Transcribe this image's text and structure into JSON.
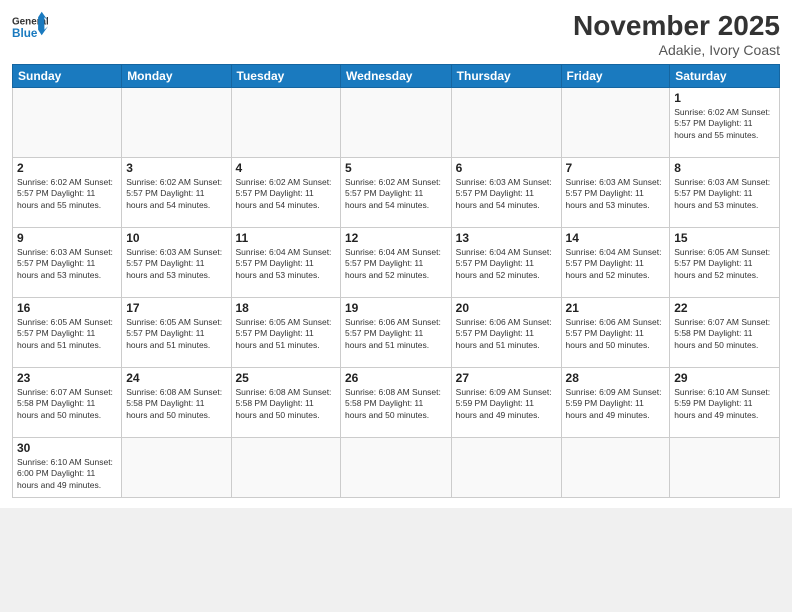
{
  "logo": {
    "text_general": "General",
    "text_blue": "Blue"
  },
  "header": {
    "month": "November 2025",
    "location": "Adakie, Ivory Coast"
  },
  "days_of_week": [
    "Sunday",
    "Monday",
    "Tuesday",
    "Wednesday",
    "Thursday",
    "Friday",
    "Saturday"
  ],
  "weeks": [
    [
      {
        "day": "",
        "info": ""
      },
      {
        "day": "",
        "info": ""
      },
      {
        "day": "",
        "info": ""
      },
      {
        "day": "",
        "info": ""
      },
      {
        "day": "",
        "info": ""
      },
      {
        "day": "",
        "info": ""
      },
      {
        "day": "1",
        "info": "Sunrise: 6:02 AM\nSunset: 5:57 PM\nDaylight: 11 hours\nand 55 minutes."
      }
    ],
    [
      {
        "day": "2",
        "info": "Sunrise: 6:02 AM\nSunset: 5:57 PM\nDaylight: 11 hours\nand 55 minutes."
      },
      {
        "day": "3",
        "info": "Sunrise: 6:02 AM\nSunset: 5:57 PM\nDaylight: 11 hours\nand 54 minutes."
      },
      {
        "day": "4",
        "info": "Sunrise: 6:02 AM\nSunset: 5:57 PM\nDaylight: 11 hours\nand 54 minutes."
      },
      {
        "day": "5",
        "info": "Sunrise: 6:02 AM\nSunset: 5:57 PM\nDaylight: 11 hours\nand 54 minutes."
      },
      {
        "day": "6",
        "info": "Sunrise: 6:03 AM\nSunset: 5:57 PM\nDaylight: 11 hours\nand 54 minutes."
      },
      {
        "day": "7",
        "info": "Sunrise: 6:03 AM\nSunset: 5:57 PM\nDaylight: 11 hours\nand 53 minutes."
      },
      {
        "day": "8",
        "info": "Sunrise: 6:03 AM\nSunset: 5:57 PM\nDaylight: 11 hours\nand 53 minutes."
      }
    ],
    [
      {
        "day": "9",
        "info": "Sunrise: 6:03 AM\nSunset: 5:57 PM\nDaylight: 11 hours\nand 53 minutes."
      },
      {
        "day": "10",
        "info": "Sunrise: 6:03 AM\nSunset: 5:57 PM\nDaylight: 11 hours\nand 53 minutes."
      },
      {
        "day": "11",
        "info": "Sunrise: 6:04 AM\nSunset: 5:57 PM\nDaylight: 11 hours\nand 53 minutes."
      },
      {
        "day": "12",
        "info": "Sunrise: 6:04 AM\nSunset: 5:57 PM\nDaylight: 11 hours\nand 52 minutes."
      },
      {
        "day": "13",
        "info": "Sunrise: 6:04 AM\nSunset: 5:57 PM\nDaylight: 11 hours\nand 52 minutes."
      },
      {
        "day": "14",
        "info": "Sunrise: 6:04 AM\nSunset: 5:57 PM\nDaylight: 11 hours\nand 52 minutes."
      },
      {
        "day": "15",
        "info": "Sunrise: 6:05 AM\nSunset: 5:57 PM\nDaylight: 11 hours\nand 52 minutes."
      }
    ],
    [
      {
        "day": "16",
        "info": "Sunrise: 6:05 AM\nSunset: 5:57 PM\nDaylight: 11 hours\nand 51 minutes."
      },
      {
        "day": "17",
        "info": "Sunrise: 6:05 AM\nSunset: 5:57 PM\nDaylight: 11 hours\nand 51 minutes."
      },
      {
        "day": "18",
        "info": "Sunrise: 6:05 AM\nSunset: 5:57 PM\nDaylight: 11 hours\nand 51 minutes."
      },
      {
        "day": "19",
        "info": "Sunrise: 6:06 AM\nSunset: 5:57 PM\nDaylight: 11 hours\nand 51 minutes."
      },
      {
        "day": "20",
        "info": "Sunrise: 6:06 AM\nSunset: 5:57 PM\nDaylight: 11 hours\nand 51 minutes."
      },
      {
        "day": "21",
        "info": "Sunrise: 6:06 AM\nSunset: 5:57 PM\nDaylight: 11 hours\nand 50 minutes."
      },
      {
        "day": "22",
        "info": "Sunrise: 6:07 AM\nSunset: 5:58 PM\nDaylight: 11 hours\nand 50 minutes."
      }
    ],
    [
      {
        "day": "23",
        "info": "Sunrise: 6:07 AM\nSunset: 5:58 PM\nDaylight: 11 hours\nand 50 minutes."
      },
      {
        "day": "24",
        "info": "Sunrise: 6:08 AM\nSunset: 5:58 PM\nDaylight: 11 hours\nand 50 minutes."
      },
      {
        "day": "25",
        "info": "Sunrise: 6:08 AM\nSunset: 5:58 PM\nDaylight: 11 hours\nand 50 minutes."
      },
      {
        "day": "26",
        "info": "Sunrise: 6:08 AM\nSunset: 5:58 PM\nDaylight: 11 hours\nand 50 minutes."
      },
      {
        "day": "27",
        "info": "Sunrise: 6:09 AM\nSunset: 5:59 PM\nDaylight: 11 hours\nand 49 minutes."
      },
      {
        "day": "28",
        "info": "Sunrise: 6:09 AM\nSunset: 5:59 PM\nDaylight: 11 hours\nand 49 minutes."
      },
      {
        "day": "29",
        "info": "Sunrise: 6:10 AM\nSunset: 5:59 PM\nDaylight: 11 hours\nand 49 minutes."
      }
    ],
    [
      {
        "day": "30",
        "info": "Sunrise: 6:10 AM\nSunset: 6:00 PM\nDaylight: 11 hours\nand 49 minutes."
      },
      {
        "day": "",
        "info": ""
      },
      {
        "day": "",
        "info": ""
      },
      {
        "day": "",
        "info": ""
      },
      {
        "day": "",
        "info": ""
      },
      {
        "day": "",
        "info": ""
      },
      {
        "day": "",
        "info": ""
      }
    ]
  ]
}
